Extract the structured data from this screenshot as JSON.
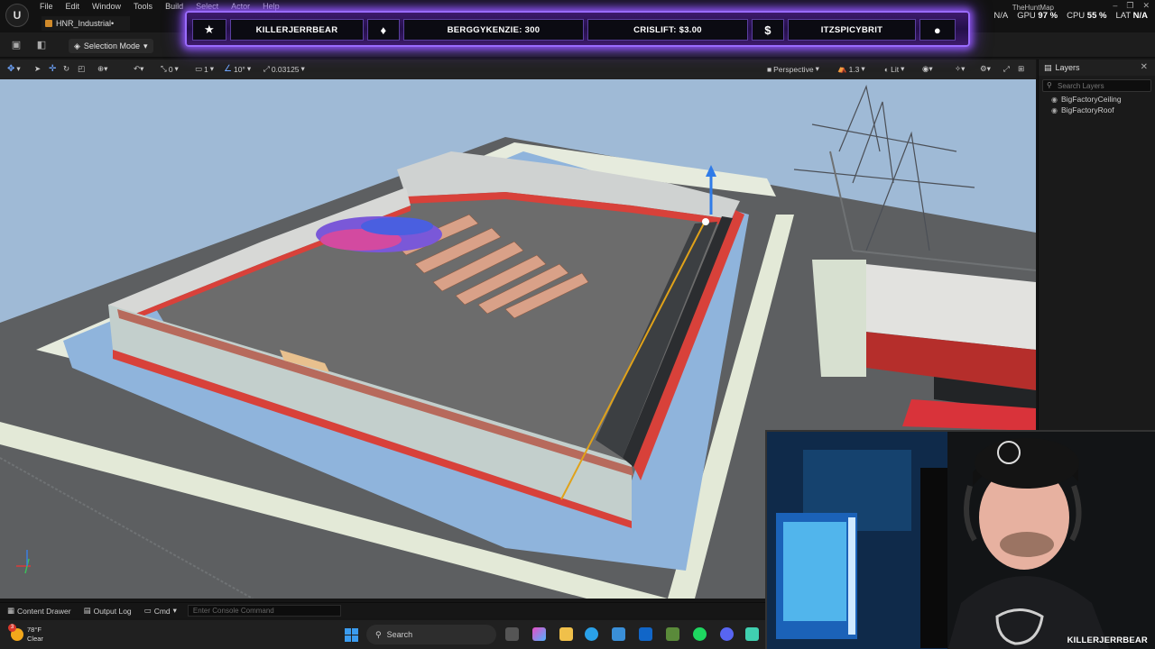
{
  "menubar": {
    "items": [
      "File",
      "Edit",
      "Window",
      "Tools",
      "Build",
      "Select",
      "Actor",
      "Help"
    ],
    "map_name": "TheHuntMap"
  },
  "tab": {
    "label": "HNR_Industrial•"
  },
  "toolbar": {
    "selection_mode": "Selection Mode"
  },
  "perf": {
    "na_label": "N/A",
    "gpu_label": "GPU",
    "gpu_value": "97 %",
    "cpu_label": "CPU",
    "cpu_value": "55 %",
    "lat_label": "LAT",
    "lat_value": "N/A"
  },
  "banner": {
    "segments": [
      {
        "icon": "star-icon",
        "glyph": "★"
      },
      {
        "text": "KILLERJERRBEAR"
      },
      {
        "icon": "drop-icon",
        "glyph": "♦"
      },
      {
        "text": "BERGGYKENZIE: 300"
      },
      {
        "text": "CRISLIFT: $3.00"
      },
      {
        "icon": "dollar-icon",
        "glyph": "$"
      },
      {
        "text": "ITZSPICYBRIT"
      },
      {
        "icon": "user-icon",
        "glyph": "●"
      }
    ]
  },
  "viewport_toolbar": {
    "rotate_snap": "0",
    "scale_snap": "1",
    "angle_snap": "10°",
    "grid_size": "0.03125",
    "view_mode": "Perspective",
    "camera_speed": "1.3",
    "lighting": "Lit"
  },
  "layers": {
    "title": "Layers",
    "search_placeholder": "Search Layers",
    "rows": [
      "BigFactoryCeiling",
      "BigFactoryRoof"
    ]
  },
  "statusbar": {
    "content_drawer": "Content Drawer",
    "output_log": "Output Log",
    "cmd": "Cmd",
    "console_placeholder": "Enter Console Command"
  },
  "taskbar": {
    "temp": "78°F",
    "condition": "Clear",
    "badge": "3",
    "search": "Search"
  },
  "webcam": {
    "label": "KILLERJERRBEAR"
  },
  "colors": {
    "banner_glow": "#9a6bff",
    "accent_blue": "#3b9cf0",
    "gizmo_yellow": "#e0a21a"
  }
}
